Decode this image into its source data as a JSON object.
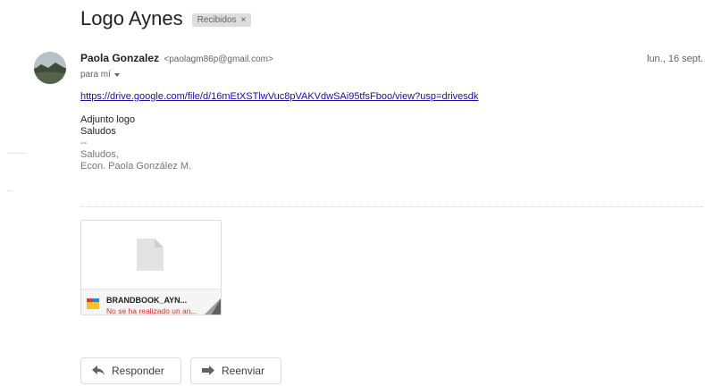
{
  "email": {
    "subject": "Logo Aynes",
    "label": "Recibidos",
    "label_remove": "×",
    "sender_name": "Paola Gonzalez",
    "sender_email": "<paolagm86p@gmail.com>",
    "date": "lun., 16 sept.",
    "to": "para mí",
    "link": "https://drive.google.com/file/d/16mEtXSTlwVuc8pVAKVdwSAi95tfsFboo/view?usp=drivesdk",
    "body_lines": [
      "Adjunto logo",
      "Saludos"
    ],
    "signature_lines": [
      "--",
      "Saludos,",
      "Econ. Paola González M."
    ]
  },
  "attachment": {
    "name": "BRANDBOOK_AYN...",
    "status": "No se ha realizado un an..."
  },
  "actions": {
    "reply_label": "Responder",
    "forward_label": "Reenviar"
  },
  "colors": {
    "link": "#1a0dab",
    "error": "#d93025",
    "label_chip": "#dddddd"
  }
}
